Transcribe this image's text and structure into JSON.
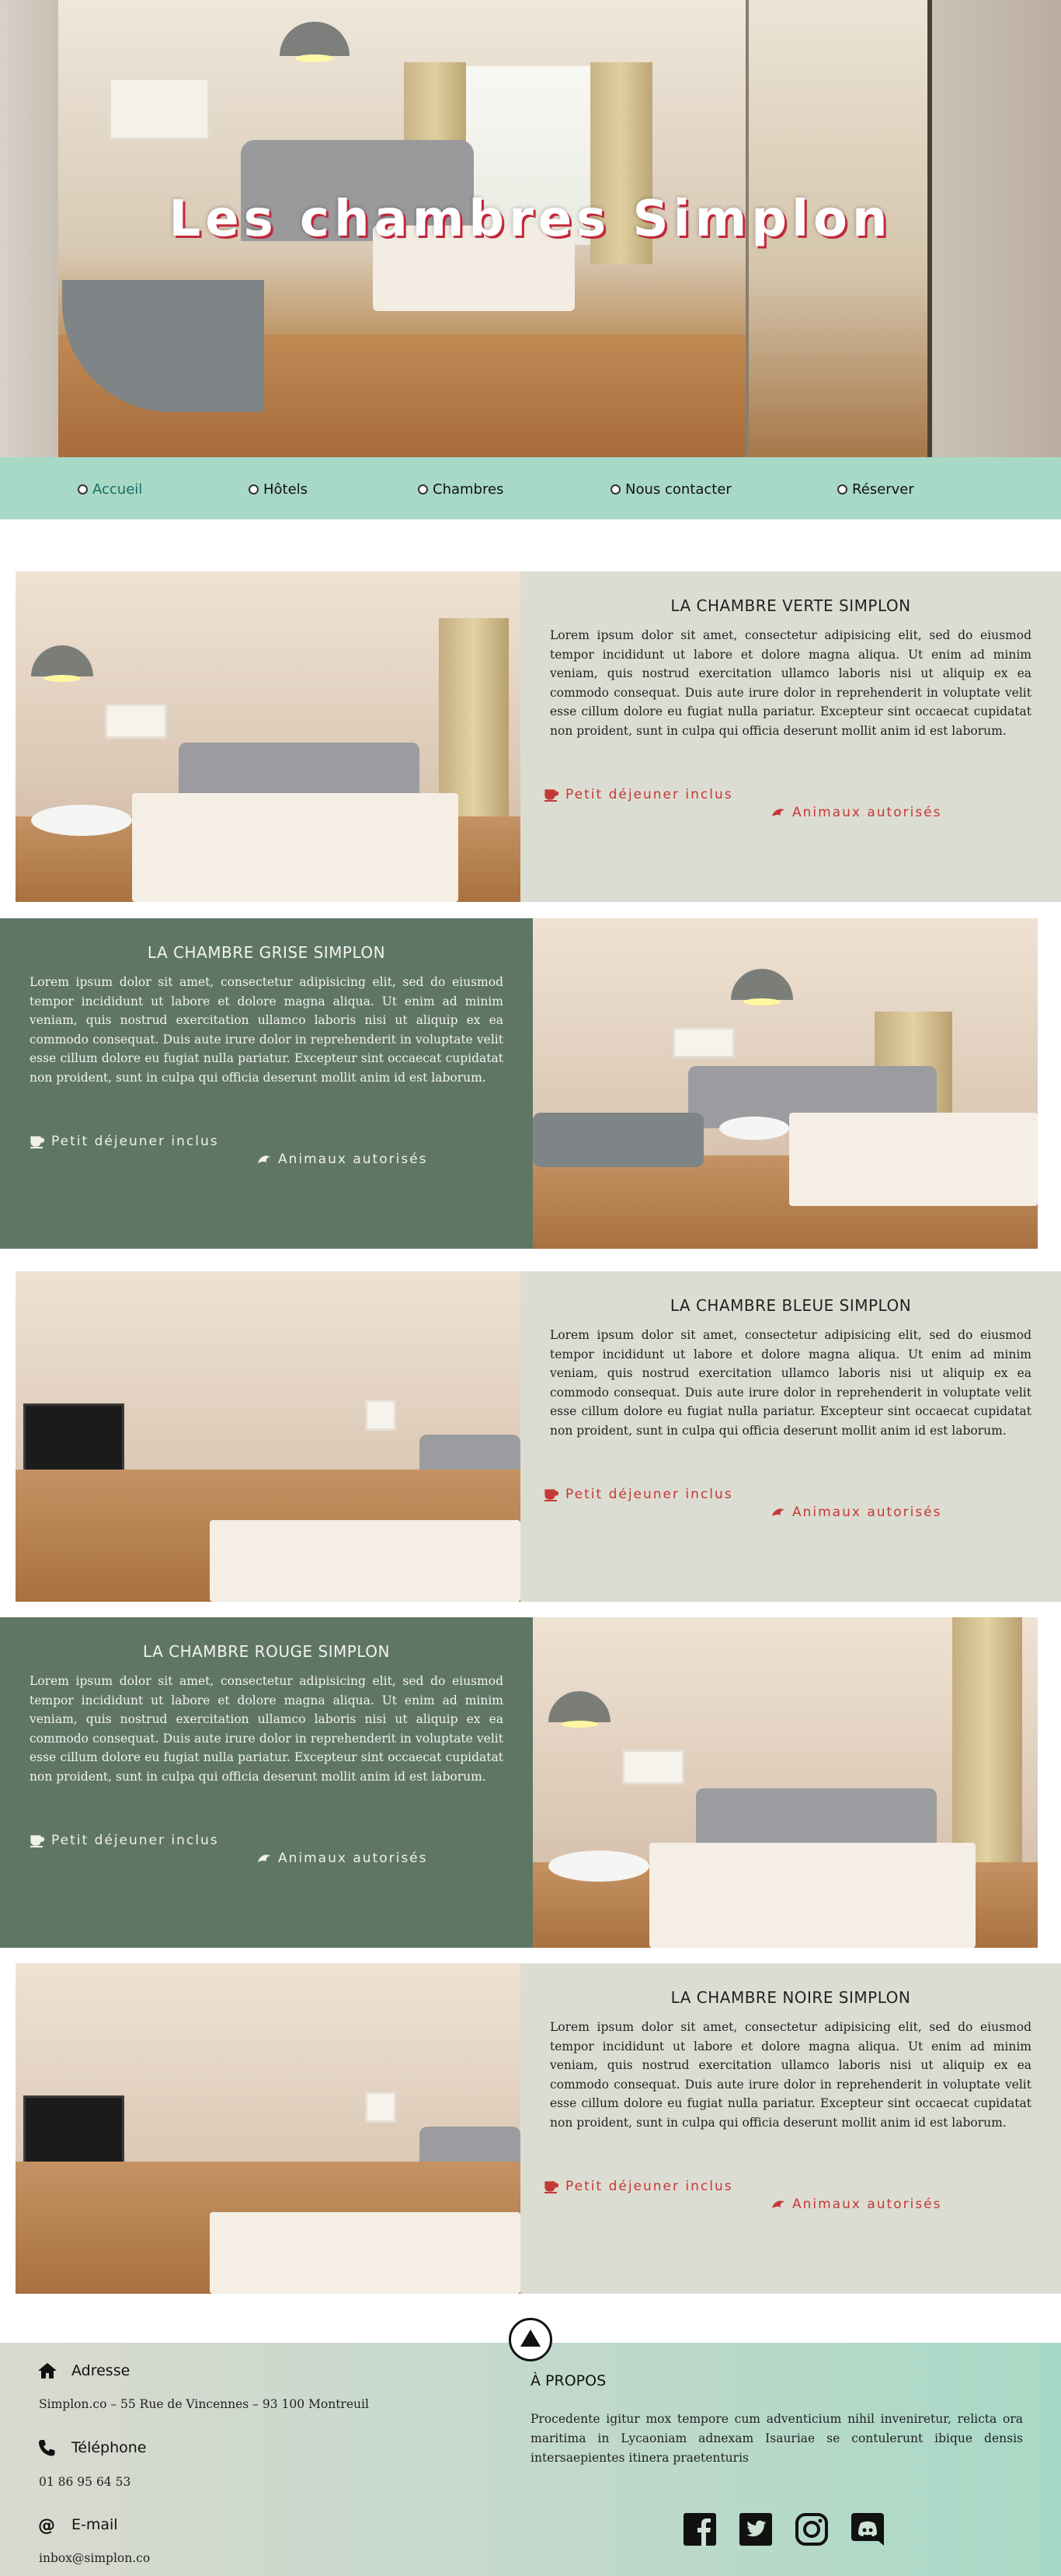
{
  "hero": {
    "title": "Les chambres Simplon"
  },
  "nav": {
    "items": [
      {
        "label": "Accueil"
      },
      {
        "label": "Hôtels"
      },
      {
        "label": "Chambres"
      },
      {
        "label": "Nous contacter"
      },
      {
        "label": "Réserver"
      }
    ]
  },
  "rooms": [
    {
      "title": "LA CHAMBRE VERTE SIMPLON",
      "text": "Lorem ipsum dolor sit amet, consectetur adipisicing elit, sed do eiusmod tempor incididunt ut labore et dolore magna aliqua. Ut enim ad minim veniam, quis nostrud exercitation ullamco laboris nisi ut aliquip ex ea commodo consequat. Duis aute irure dolor in reprehenderit in voluptate velit esse cillum dolore eu fugiat nulla pariatur. Excepteur sint occaecat cupidatat non proident, sunt in culpa qui officia deserunt mollit anim id est laborum.",
      "breakfast": "Petit déjeuner inclus",
      "pets": "Animaux autorisés"
    },
    {
      "title": "LA CHAMBRE GRISE SIMPLON",
      "text": "Lorem ipsum dolor sit amet, consectetur adipisicing elit, sed do eiusmod tempor incididunt ut labore et dolore magna aliqua. Ut enim ad minim veniam, quis nostrud exercitation ullamco laboris nisi ut aliquip ex ea commodo consequat. Duis aute irure dolor in reprehenderit in voluptate velit esse cillum dolore eu fugiat nulla pariatur. Excepteur sint occaecat cupidatat non proident, sunt in culpa qui officia deserunt mollit anim id est laborum.",
      "breakfast": "Petit déjeuner inclus",
      "pets": "Animaux autorisés"
    },
    {
      "title": "LA CHAMBRE BLEUE SIMPLON",
      "text": "Lorem ipsum dolor sit amet, consectetur adipisicing elit, sed do eiusmod tempor incididunt ut labore et dolore magna aliqua. Ut enim ad minim veniam, quis nostrud exercitation ullamco laboris nisi ut aliquip ex ea commodo consequat. Duis aute irure dolor in reprehenderit in voluptate velit esse cillum dolore eu fugiat nulla pariatur. Excepteur sint occaecat cupidatat non proident, sunt in culpa qui officia deserunt mollit anim id est laborum.",
      "breakfast": "Petit déjeuner inclus",
      "pets": "Animaux autorisés"
    },
    {
      "title": "LA CHAMBRE ROUGE SIMPLON",
      "text": "Lorem ipsum dolor sit amet, consectetur adipisicing elit, sed do eiusmod tempor incididunt ut labore et dolore magna aliqua. Ut enim ad minim veniam, quis nostrud exercitation ullamco laboris nisi ut aliquip ex ea commodo consequat. Duis aute irure dolor in reprehenderit in voluptate velit esse cillum dolore eu fugiat nulla pariatur. Excepteur sint occaecat cupidatat non proident, sunt in culpa qui officia deserunt mollit anim id est laborum.",
      "breakfast": "Petit déjeuner inclus",
      "pets": "Animaux autorisés"
    },
    {
      "title": "LA CHAMBRE NOIRE SIMPLON",
      "text": "Lorem ipsum dolor sit amet, consectetur adipisicing elit, sed do eiusmod tempor incididunt ut labore et dolore magna aliqua. Ut enim ad minim veniam, quis nostrud exercitation ullamco laboris nisi ut aliquip ex ea commodo consequat. Duis aute irure dolor in reprehenderit in voluptate velit esse cillum dolore eu fugiat nulla pariatur. Excepteur sint occaecat cupidatat non proident, sunt in culpa qui officia deserunt mollit anim id est laborum.",
      "breakfast": "Petit déjeuner inclus",
      "pets": "Animaux autorisés"
    }
  ],
  "footer": {
    "address_label": "Adresse",
    "address_value": "Simplon.co – 55 Rue de Vincennes – 93 100 Montreuil",
    "phone_label": "Téléphone",
    "phone_value": "01 86 95 64 53",
    "email_label": "E-mail",
    "email_value": "inbox@simplon.co",
    "about_title": "À PROPOS",
    "about_text": "Procedente igitur mox tempore cum adventicium nihil inveniretur, relicta ora maritima in Lycaoniam adnexam Isauriae se contulerunt ibique densis intersaepientes itinera praetenturis",
    "icons": [
      "home-icon",
      "phone-icon",
      "at-icon",
      "facebook-icon",
      "twitter-icon",
      "instagram-icon",
      "discord-icon",
      "arrow-up-icon"
    ]
  },
  "colors": {
    "nav_bg": "#a8d9c6",
    "light_panel": "#dcddd2",
    "dark_panel": "#5f7665",
    "feature_red": "#c53838",
    "title_shadow": "#c1273b"
  }
}
